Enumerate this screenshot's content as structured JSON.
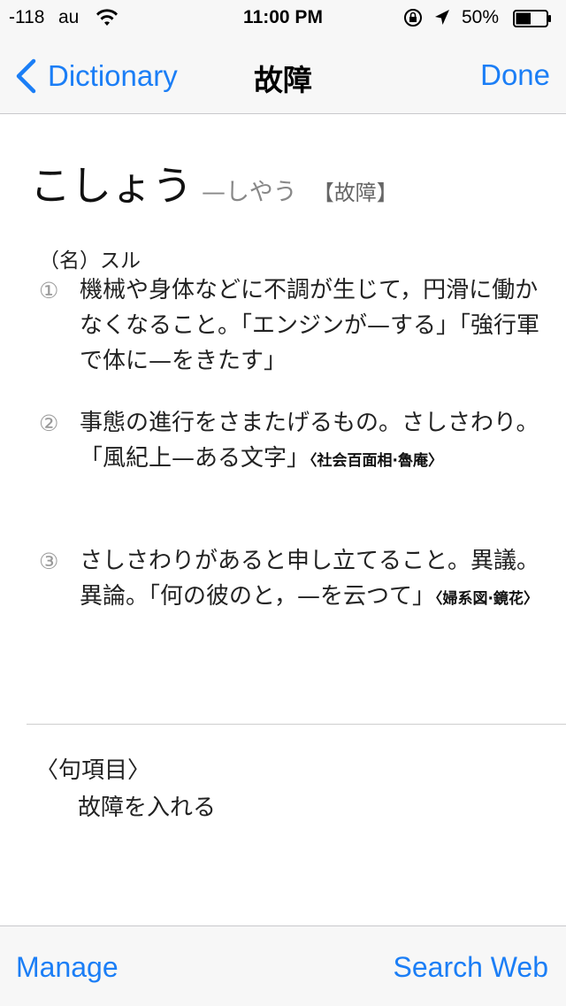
{
  "status_bar": {
    "signal": "-118",
    "carrier": "au",
    "time": "11:00 PM",
    "battery_percent": "50%",
    "battery_level": 0.5
  },
  "nav": {
    "back_label": "Dictionary",
    "title": "故障",
    "done_label": "Done"
  },
  "entry": {
    "headword": "こしょう",
    "historical_reading": "—しやう",
    "kanji": "【故障】",
    "part_of_speech": "（名）スル",
    "senses": [
      {
        "number": "①",
        "text": "機械や身体などに不調が生じて，円滑に働かなくなること。「エンジンが—する」「強行軍で体に—をきたす」",
        "source": ""
      },
      {
        "number": "②",
        "text": "事態の進行をさまたげるもの。さしさわり。「風紀上—ある文字」",
        "source": "〈社会百面相·魯庵〉"
      },
      {
        "number": "③",
        "text": "さしさわりがあると申し立てること。異議。異論。「何の彼のと，—を云つて」",
        "source": "〈婦系図·鏡花〉"
      }
    ],
    "phrase_header": "〈句項目〉",
    "phrases": [
      "故障を入れる"
    ]
  },
  "toolbar": {
    "manage_label": "Manage",
    "search_web_label": "Search Web"
  },
  "colors": {
    "accent": "#1b7ef6",
    "bar_background": "#f7f7f7"
  }
}
